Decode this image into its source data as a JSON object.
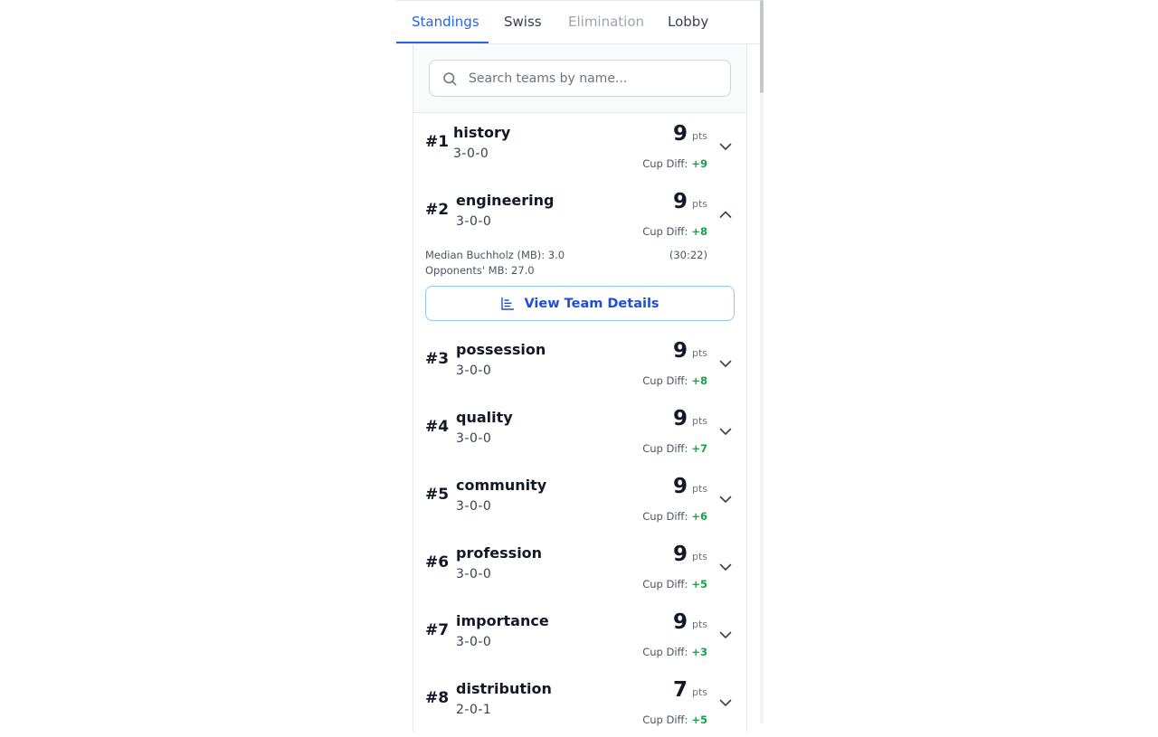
{
  "tabs": [
    {
      "label": "Standings",
      "state": "active"
    },
    {
      "label": "Swiss",
      "state": "normal"
    },
    {
      "label": "Elimination",
      "state": "disabled"
    },
    {
      "label": "Lobby",
      "state": "normal"
    }
  ],
  "search": {
    "placeholder": "Search teams by name...",
    "value": ""
  },
  "labels": {
    "pts": "pts",
    "cup_diff": "Cup Diff:"
  },
  "expanded": {
    "median_buchholz": "Median Buchholz (MB): 3.0",
    "opponents_mb": "Opponents' MB: 27.0",
    "cups": "(30:22)",
    "view_details_label": "View Team Details"
  },
  "teams": [
    {
      "rank": "#1",
      "name": "history",
      "record": "3-0-0",
      "pts": "9",
      "cup_diff": "+9",
      "expanded": false
    },
    {
      "rank": "#2",
      "name": "engineering",
      "record": "3-0-0",
      "pts": "9",
      "cup_diff": "+8",
      "expanded": true
    },
    {
      "rank": "#3",
      "name": "possession",
      "record": "3-0-0",
      "pts": "9",
      "cup_diff": "+8",
      "expanded": false
    },
    {
      "rank": "#4",
      "name": "quality",
      "record": "3-0-0",
      "pts": "9",
      "cup_diff": "+7",
      "expanded": false
    },
    {
      "rank": "#5",
      "name": "community",
      "record": "3-0-0",
      "pts": "9",
      "cup_diff": "+6",
      "expanded": false
    },
    {
      "rank": "#6",
      "name": "profession",
      "record": "3-0-0",
      "pts": "9",
      "cup_diff": "+5",
      "expanded": false
    },
    {
      "rank": "#7",
      "name": "importance",
      "record": "3-0-0",
      "pts": "9",
      "cup_diff": "+3",
      "expanded": false
    },
    {
      "rank": "#8",
      "name": "distribution",
      "record": "2-0-1",
      "pts": "7",
      "cup_diff": "+5",
      "expanded": false
    }
  ],
  "colors": {
    "accent": "#2563eb",
    "positive": "#16a34a",
    "border": "#e5e7eb"
  },
  "icons": {
    "search": "search-icon",
    "expand": "chevron-down-icon",
    "collapse": "chevron-up-icon",
    "details": "bar-chart-icon"
  }
}
